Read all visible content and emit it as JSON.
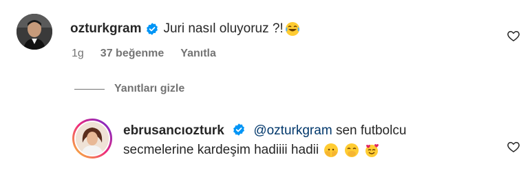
{
  "comment": {
    "username": "ozturkgram",
    "text": "Juri nasıl oluyoruz ?!",
    "emoji": "😂",
    "meta": {
      "time": "1g",
      "likes": "37 beğenme",
      "reply": "Yanıtla"
    }
  },
  "replies_toggle": {
    "label": "Yanıtları gizle"
  },
  "reply": {
    "username": "ebrusancıozturk",
    "mention": "@ozturkgram",
    "text_line1": "sen futbolcu",
    "text_line2": "secmelerine kardeşim hadiiii hadii",
    "emojis": [
      "🫣",
      "🤭",
      "🥰"
    ]
  },
  "colors": {
    "verified": "#0095f6",
    "mention": "#00376b",
    "meta": "#737373",
    "text": "#262626"
  }
}
